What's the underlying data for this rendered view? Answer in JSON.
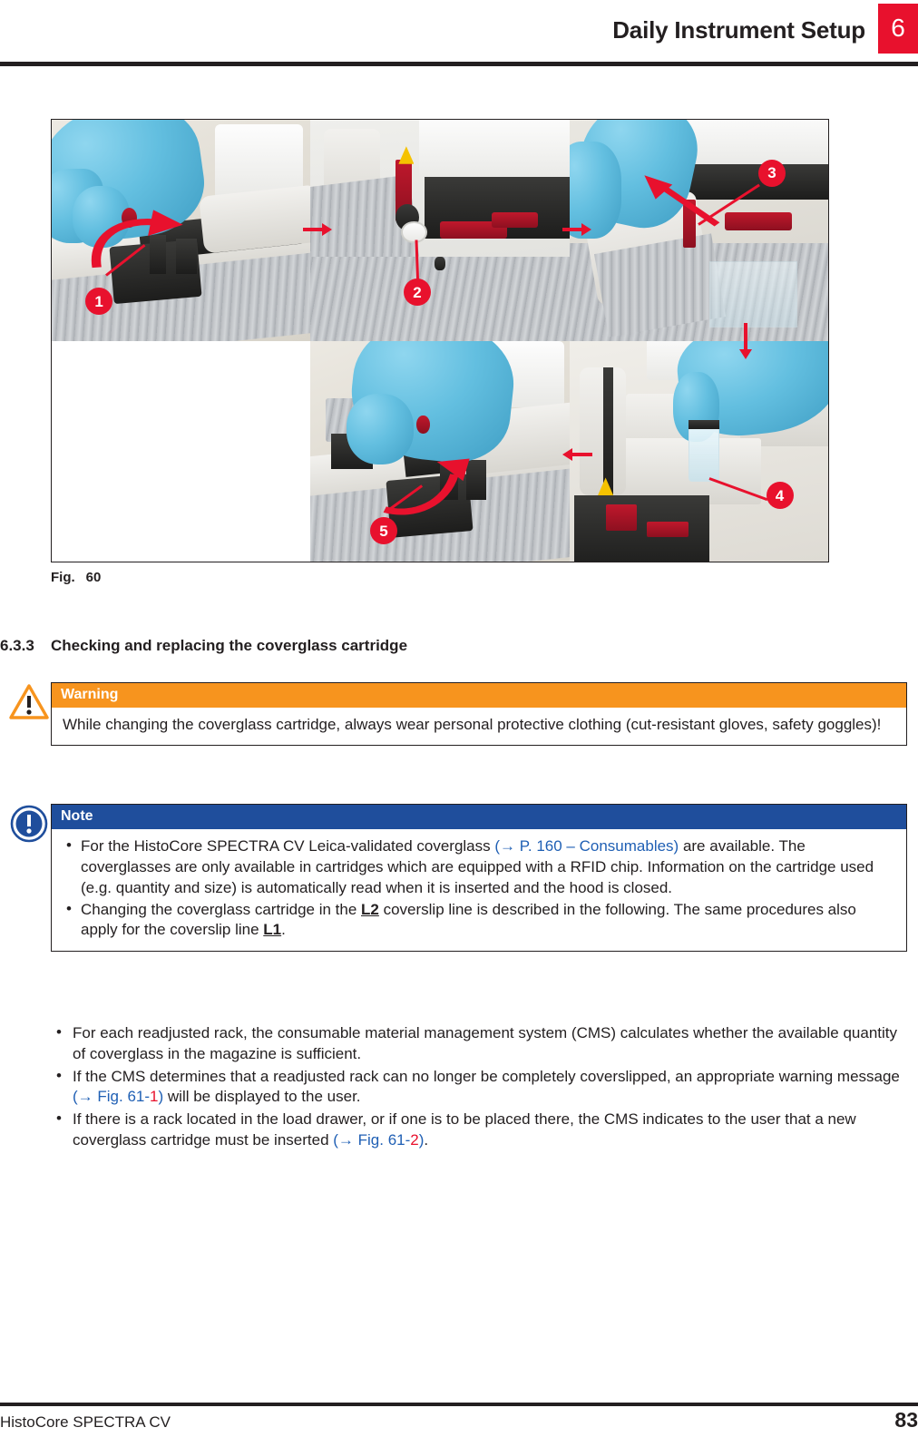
{
  "header": {
    "title": "Daily Instrument Setup",
    "chapter_number": "6",
    "accent_red": "#e8112d"
  },
  "figure": {
    "caption_label": "Fig.",
    "caption_number": "60",
    "panels": [
      {
        "id": "panel-1",
        "callout": "1",
        "description": "Gloved hand removing the black cover plate from the coverslip line"
      },
      {
        "id": "panel-2",
        "callout": "2",
        "description": "Open instrument showing the white coverglass cartridge seat"
      },
      {
        "id": "panel-3",
        "callout": "3",
        "description": "Gloved hand lifting the grey cover of the coverslip line"
      },
      {
        "id": "panel-4",
        "callout": "4",
        "description": "Gloved hand holding the glass vial above the instrument"
      },
      {
        "id": "panel-5",
        "callout": "5",
        "description": "Gloved hand refitting the black cover plate"
      }
    ]
  },
  "section": {
    "number": "6.3.3",
    "title": "Checking and replacing the coverglass cartridge"
  },
  "warning": {
    "icon": "warning-triangle-icon",
    "header": "Warning",
    "header_color": "#f7941e",
    "body": "While changing the coverglass cartridge, always wear personal protective clothing (cut-resistant gloves, safety goggles)!"
  },
  "note": {
    "icon": "note-exclamation-icon",
    "header": "Note",
    "header_color": "#1f4e9c",
    "items": [
      {
        "parts": [
          {
            "text": "For the HistoCore SPECTRA CV Leica-validated coverglass ",
            "style": "plain"
          },
          {
            "text": "(→ P. 160 – Consumables)",
            "style": "link"
          },
          {
            "text": " are available. The coverglasses are only available in cartridges which are equipped with a RFID chip. Information on the cartridge used (e.g. quantity and size) is automatically read when it is inserted and the hood is closed.",
            "style": "plain"
          }
        ]
      },
      {
        "parts": [
          {
            "text": "Changing the coverglass cartridge in the ",
            "style": "plain"
          },
          {
            "text": "L2",
            "style": "bold-underline"
          },
          {
            "text": " coverslip line is described in the following. The same procedures also apply for the coverslip line ",
            "style": "plain"
          },
          {
            "text": "L1",
            "style": "bold-underline"
          },
          {
            "text": ".",
            "style": "plain"
          }
        ]
      }
    ]
  },
  "body_bullets": [
    {
      "parts": [
        {
          "text": "For each readjusted rack, the consumable material management system (CMS) calculates whether the available quantity of coverglass in the magazine is sufficient.",
          "style": "plain"
        }
      ]
    },
    {
      "parts": [
        {
          "text": "If the CMS determines that a readjusted rack can no longer be completely coverslipped, an appropriate warning message ",
          "style": "plain"
        },
        {
          "text": "(→ Fig.  61-",
          "style": "link"
        },
        {
          "text": "1",
          "style": "link-red"
        },
        {
          "text": ")",
          "style": "link"
        },
        {
          "text": " will be displayed to the user.",
          "style": "plain"
        }
      ]
    },
    {
      "parts": [
        {
          "text": "If there is a rack located in the load drawer, or if one is to be placed there, the CMS indicates to the user that a new coverglass cartridge must be inserted ",
          "style": "plain"
        },
        {
          "text": "(→ Fig.  61-",
          "style": "link"
        },
        {
          "text": "2",
          "style": "link-red"
        },
        {
          "text": ")",
          "style": "link"
        },
        {
          "text": ".",
          "style": "plain"
        }
      ]
    }
  ],
  "footer": {
    "product": "HistoCore SPECTRA CV",
    "page_number": "83"
  }
}
